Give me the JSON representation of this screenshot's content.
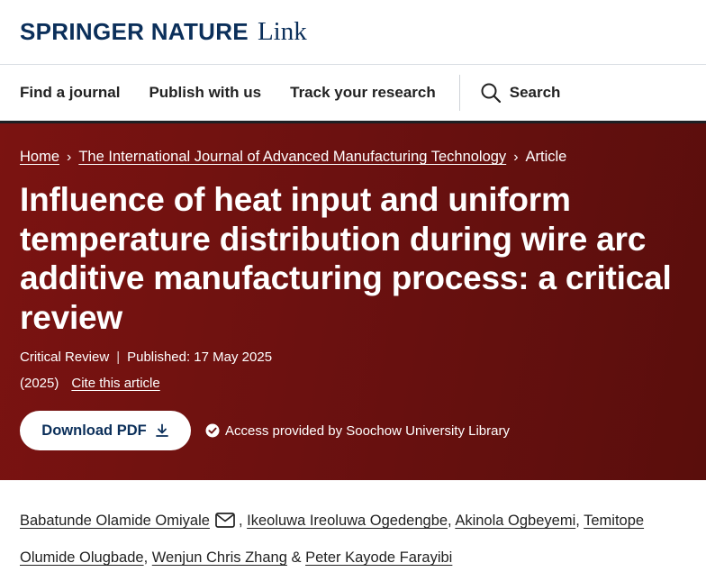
{
  "header": {
    "brand": "SPRINGER NATURE",
    "brand_suffix": "Link"
  },
  "nav": {
    "items": [
      "Find a journal",
      "Publish with us",
      "Track your research"
    ],
    "search_label": "Search",
    "search_icon": "search-icon"
  },
  "breadcrumb": {
    "home": "Home",
    "journal": "The International Journal of Advanced Manufacturing Technology",
    "current": "Article"
  },
  "article": {
    "title": "Influence of heat input and uniform temperature distribution during wire arc additive manufacturing process: a critical review",
    "type": "Critical Review",
    "published": "Published: 17 May 2025",
    "year": "(2025)",
    "cite_label": "Cite this article",
    "download_label": "Download PDF",
    "access_text": "Access provided by Soochow University Library"
  },
  "authors": {
    "list": [
      "Babatunde Olamide Omiyale",
      "Ikeoluwa Ireoluwa Ogedengbe",
      "Akinola Ogbeyemi",
      "Temitope Olumide Olugbade",
      "Wenjun Chris Zhang",
      "Peter Kayode Farayibi"
    ],
    "sep_comma": ",",
    "sep_and": "&"
  },
  "colors": {
    "brand_navy": "#0b2f5a",
    "hero_red": "#6c1110",
    "text": "#222222"
  }
}
